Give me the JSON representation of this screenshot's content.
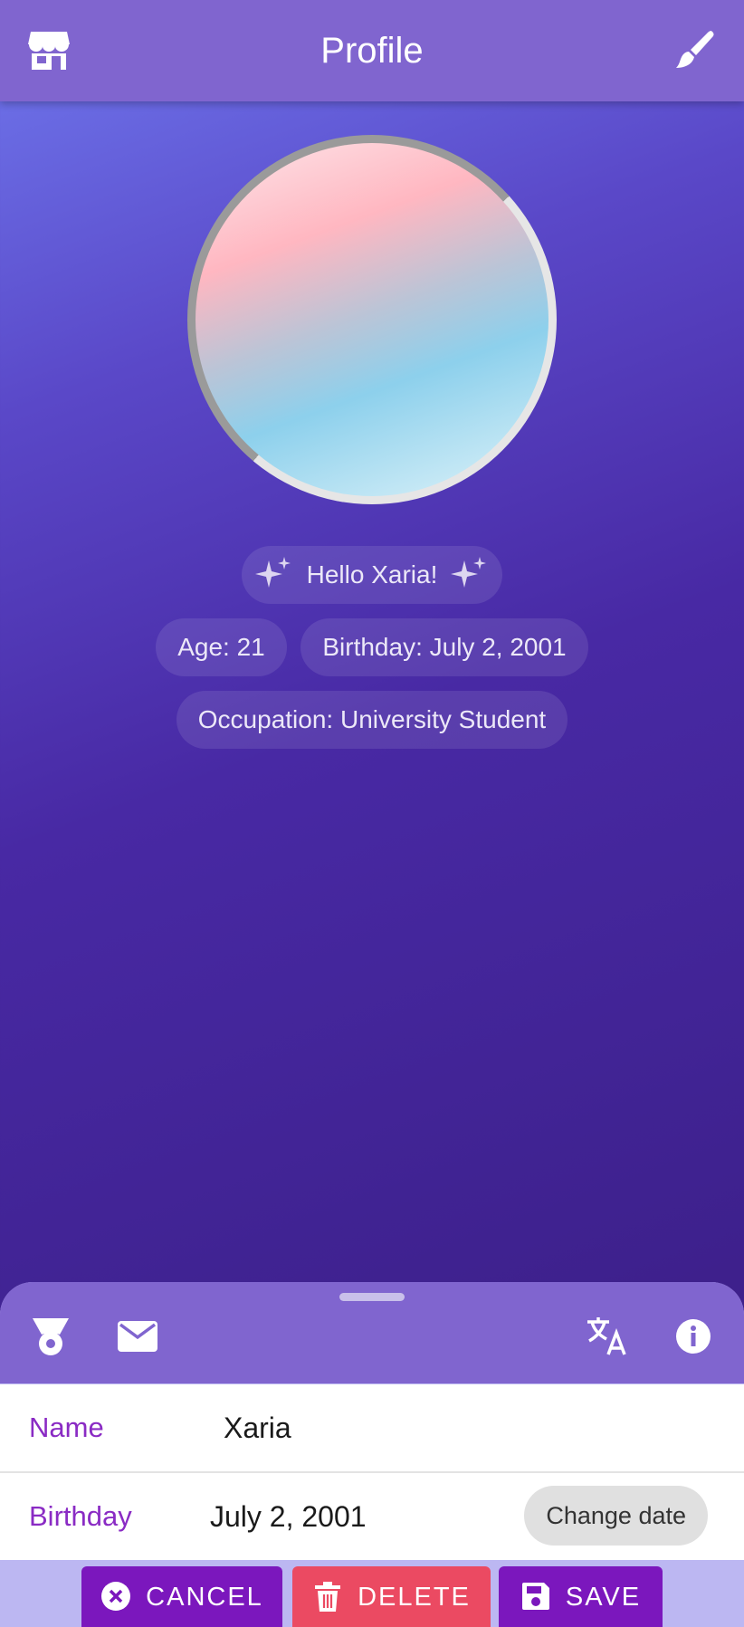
{
  "appbar": {
    "title": "Profile",
    "left_icon": "store-icon",
    "right_icon": "brush-icon"
  },
  "profile": {
    "greeting": "Hello Xaria!",
    "age": "Age: 21",
    "birthday": "Birthday: July 2, 2001",
    "occupation": "Occupation: University Student"
  },
  "sheet": {
    "icons": [
      "badge-icon",
      "mail-icon",
      "translate-icon",
      "info-icon"
    ],
    "name_label": "Name",
    "name_value": "Xaria",
    "birthday_label": "Birthday",
    "birthday_value": "July 2, 2001",
    "change_date": "Change date"
  },
  "actions": {
    "cancel": "CANCEL",
    "delete": "DELETE",
    "save": "SAVE"
  },
  "colors": {
    "appbar": "#8065cf",
    "accent": "#7b17bd",
    "danger": "#eb4a62",
    "label": "#8a2bc4"
  }
}
